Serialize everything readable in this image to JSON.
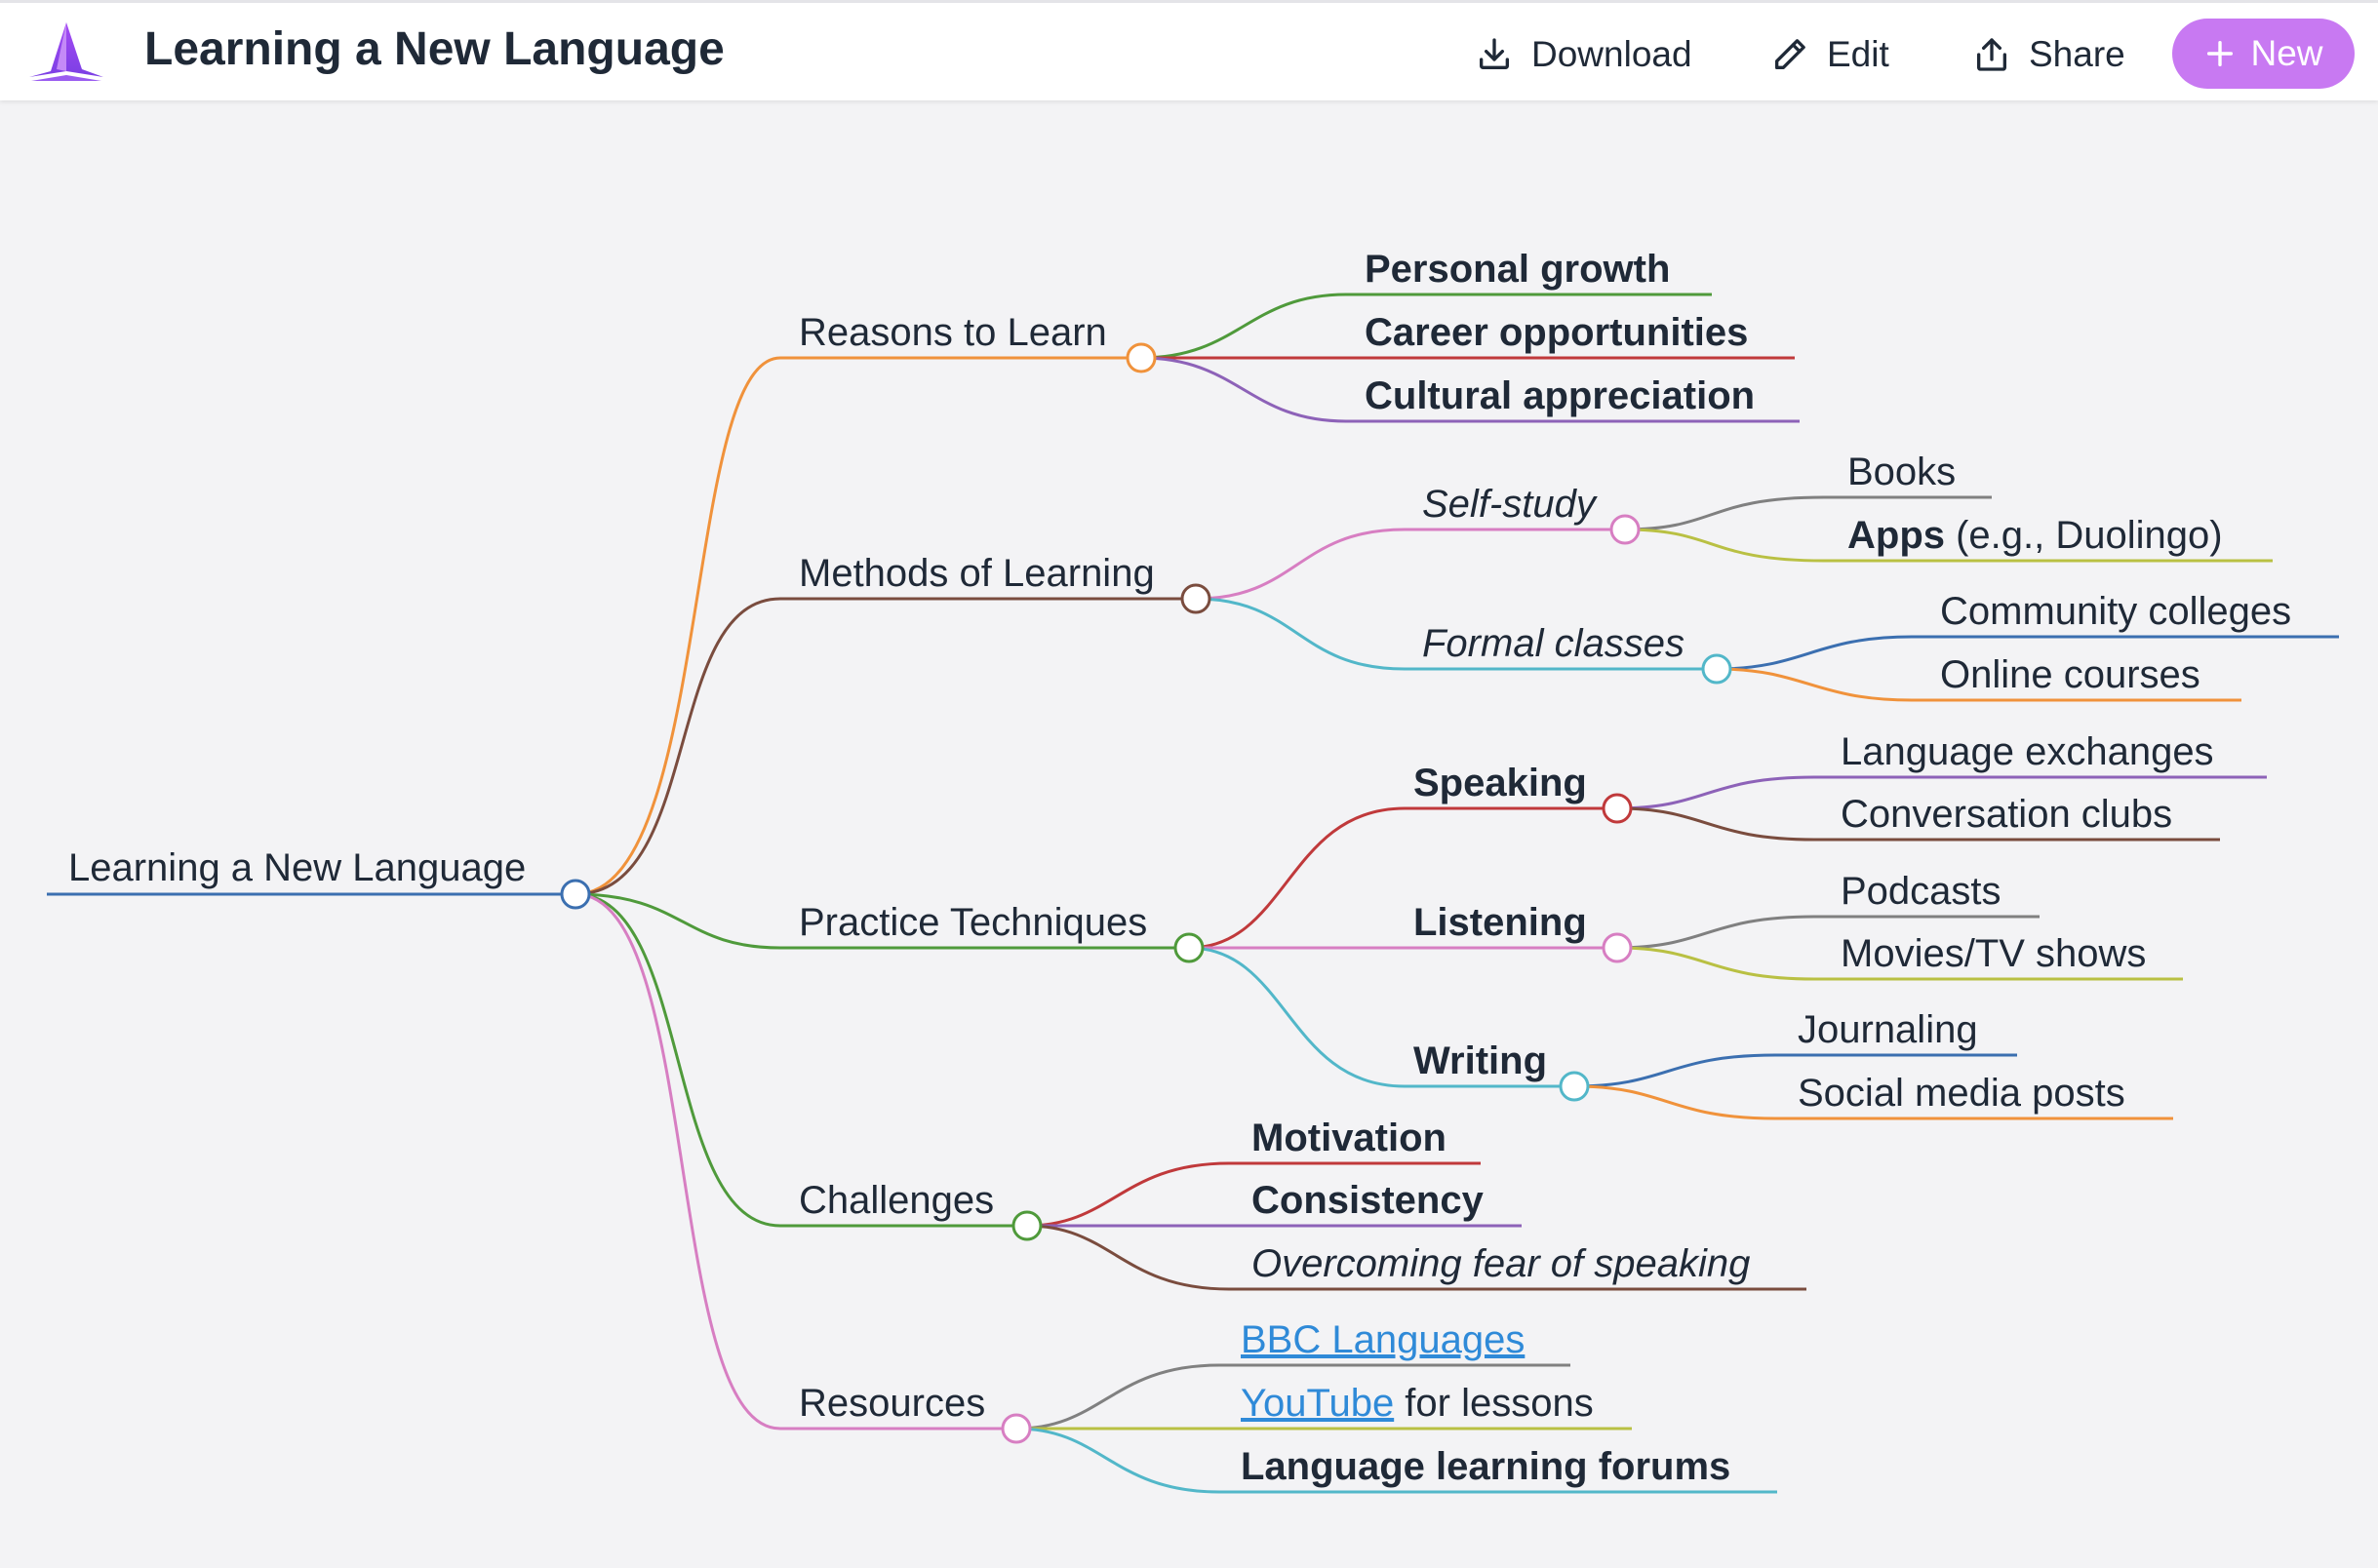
{
  "header": {
    "title": "Learning a New Language",
    "download_label": "Download",
    "edit_label": "Edit",
    "share_label": "Share",
    "new_label": "New",
    "accent_color": "#c879f2"
  },
  "mindmap": {
    "root": "Learning a New Language",
    "reasons": {
      "label": "Reasons to Learn",
      "items": [
        "Personal growth",
        "Career opportunities",
        "Cultural appreciation"
      ]
    },
    "methods": {
      "label": "Methods of Learning",
      "self_study": {
        "label": "Self-study",
        "books": "Books",
        "apps_bold": "Apps",
        "apps_rest": " (e.g., Duolingo)"
      },
      "formal": {
        "label": "Formal classes",
        "items": [
          "Community colleges",
          "Online courses"
        ]
      }
    },
    "practice": {
      "label": "Practice Techniques",
      "speaking": {
        "label": "Speaking",
        "items": [
          "Language exchanges",
          "Conversation clubs"
        ]
      },
      "listening": {
        "label": "Listening",
        "items": [
          "Podcasts",
          "Movies/TV shows"
        ]
      },
      "writing": {
        "label": "Writing",
        "items": [
          "Journaling",
          "Social media posts"
        ]
      }
    },
    "challenges": {
      "label": "Challenges",
      "items": [
        "Motivation",
        "Consistency",
        "Overcoming fear of speaking"
      ]
    },
    "resources": {
      "label": "Resources",
      "bbc": "BBC Languages",
      "youtube_link": "YouTube",
      "youtube_rest": " for lessons",
      "forums": "Language learning forums"
    }
  }
}
